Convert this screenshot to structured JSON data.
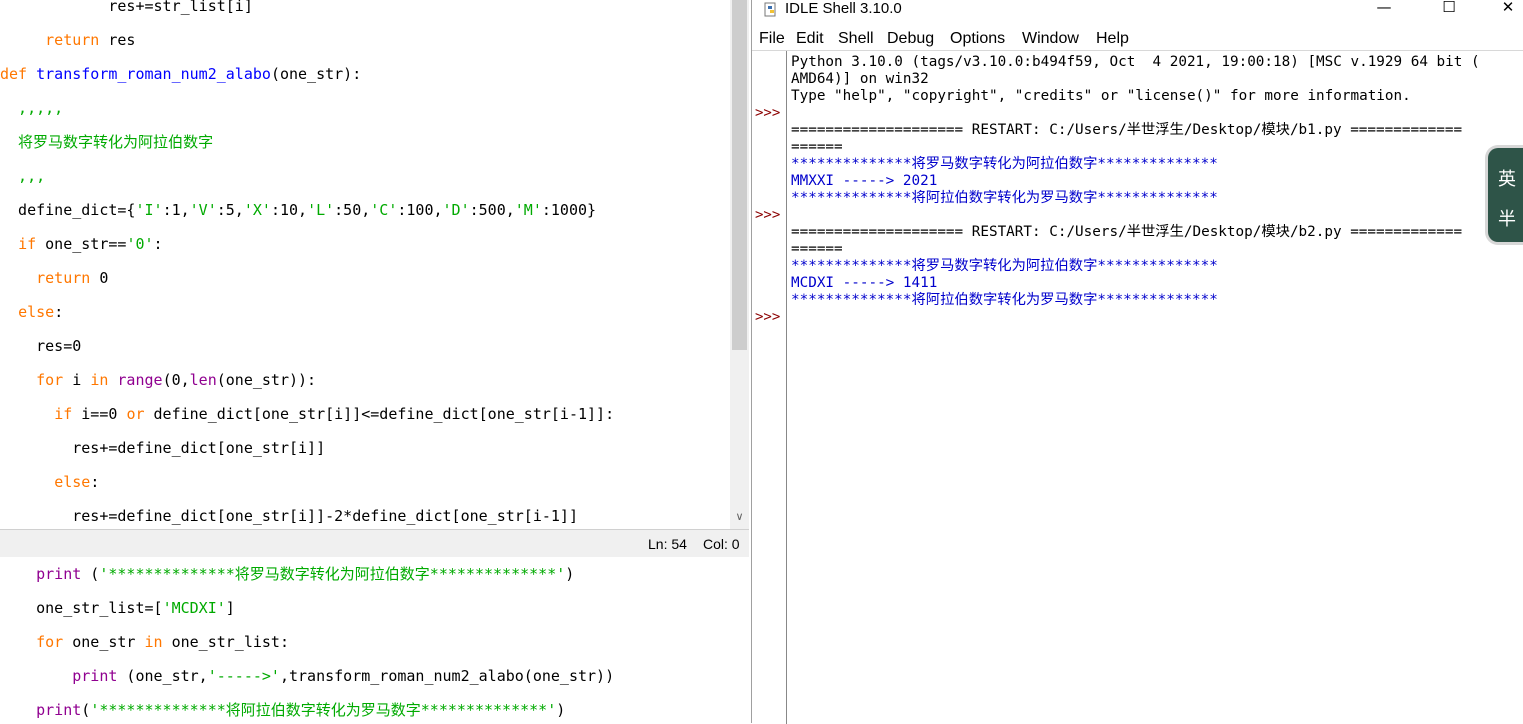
{
  "editor": {
    "lines": [
      {
        "segs": [
          {
            "t": "            res+=str_list[i]",
            "c": ""
          }
        ]
      },
      {
        "segs": [
          {
            "t": "     ",
            "c": ""
          },
          {
            "t": "return",
            "c": "kw"
          },
          {
            "t": " res",
            "c": ""
          }
        ]
      },
      {
        "segs": [
          {
            "t": "def",
            "c": "kw"
          },
          {
            "t": " ",
            "c": ""
          },
          {
            "t": "transform_roman_num2_alabo",
            "c": "def"
          },
          {
            "t": "(one_str):",
            "c": ""
          }
        ]
      },
      {
        "segs": [
          {
            "t": "  ,,,,,",
            "c": "str"
          }
        ]
      },
      {
        "segs": [
          {
            "t": "  将罗马数字转化为阿拉伯数字",
            "c": "str"
          }
        ]
      },
      {
        "segs": [
          {
            "t": "  ,,,",
            "c": "str"
          }
        ]
      },
      {
        "segs": [
          {
            "t": "  define_dict={",
            "c": ""
          },
          {
            "t": "'I'",
            "c": "str"
          },
          {
            "t": ":1,",
            "c": ""
          },
          {
            "t": "'V'",
            "c": "str"
          },
          {
            "t": ":5,",
            "c": ""
          },
          {
            "t": "'X'",
            "c": "str"
          },
          {
            "t": ":10,",
            "c": ""
          },
          {
            "t": "'L'",
            "c": "str"
          },
          {
            "t": ":50,",
            "c": ""
          },
          {
            "t": "'C'",
            "c": "str"
          },
          {
            "t": ":100,",
            "c": ""
          },
          {
            "t": "'D'",
            "c": "str"
          },
          {
            "t": ":500,",
            "c": ""
          },
          {
            "t": "'M'",
            "c": "str"
          },
          {
            "t": ":1000}",
            "c": ""
          }
        ]
      },
      {
        "segs": [
          {
            "t": "  ",
            "c": ""
          },
          {
            "t": "if",
            "c": "kw"
          },
          {
            "t": " one_str==",
            "c": ""
          },
          {
            "t": "'0'",
            "c": "str"
          },
          {
            "t": ":",
            "c": ""
          }
        ]
      },
      {
        "segs": [
          {
            "t": "    ",
            "c": ""
          },
          {
            "t": "return",
            "c": "kw"
          },
          {
            "t": " 0",
            "c": ""
          }
        ]
      },
      {
        "segs": [
          {
            "t": "  ",
            "c": ""
          },
          {
            "t": "else",
            "c": "kw"
          },
          {
            "t": ":",
            "c": ""
          }
        ]
      },
      {
        "segs": [
          {
            "t": "    res=0",
            "c": ""
          }
        ]
      },
      {
        "segs": [
          {
            "t": "    ",
            "c": ""
          },
          {
            "t": "for",
            "c": "kw"
          },
          {
            "t": " i ",
            "c": ""
          },
          {
            "t": "in",
            "c": "kw"
          },
          {
            "t": " ",
            "c": ""
          },
          {
            "t": "range",
            "c": "bi"
          },
          {
            "t": "(0,",
            "c": ""
          },
          {
            "t": "len",
            "c": "bi"
          },
          {
            "t": "(one_str)):",
            "c": ""
          }
        ]
      },
      {
        "segs": [
          {
            "t": "      ",
            "c": ""
          },
          {
            "t": "if",
            "c": "kw"
          },
          {
            "t": " i==0 ",
            "c": ""
          },
          {
            "t": "or",
            "c": "kw"
          },
          {
            "t": " define_dict[one_str[i]]<=define_dict[one_str[i-1]]:",
            "c": ""
          }
        ]
      },
      {
        "segs": [
          {
            "t": "        res+=define_dict[one_str[i]]",
            "c": ""
          }
        ]
      },
      {
        "segs": [
          {
            "t": "      ",
            "c": ""
          },
          {
            "t": "else",
            "c": "kw"
          },
          {
            "t": ":",
            "c": ""
          }
        ]
      },
      {
        "segs": [
          {
            "t": "        res+=define_dict[one_str[i]]-2*define_dict[one_str[i-1]]",
            "c": ""
          }
        ]
      }
    ],
    "lines2": [
      {
        "segs": [
          {
            "t": "    ",
            "c": ""
          },
          {
            "t": "print",
            "c": "bi"
          },
          {
            "t": " (",
            "c": ""
          },
          {
            "t": "'**************将罗马数字转化为阿拉伯数字**************'",
            "c": "str"
          },
          {
            "t": ")",
            "c": ""
          }
        ]
      },
      {
        "segs": [
          {
            "t": "    one_str_list=[",
            "c": ""
          },
          {
            "t": "'MCDXI'",
            "c": "str"
          },
          {
            "t": "]",
            "c": ""
          }
        ]
      },
      {
        "segs": [
          {
            "t": "    ",
            "c": ""
          },
          {
            "t": "for",
            "c": "kw"
          },
          {
            "t": " one_str ",
            "c": ""
          },
          {
            "t": "in",
            "c": "kw"
          },
          {
            "t": " one_str_list:",
            "c": ""
          }
        ]
      },
      {
        "segs": [
          {
            "t": "        ",
            "c": ""
          },
          {
            "t": "print",
            "c": "bi"
          },
          {
            "t": " (one_str,",
            "c": ""
          },
          {
            "t": "'----->'",
            "c": "str"
          },
          {
            "t": ",transform_roman_num2_alabo(one_str))",
            "c": ""
          }
        ]
      },
      {
        "segs": [
          {
            "t": "    ",
            "c": ""
          },
          {
            "t": "print",
            "c": "bi"
          },
          {
            "t": "(",
            "c": ""
          },
          {
            "t": "'**************将阿拉伯数字转化为罗马数字**************'",
            "c": "str"
          },
          {
            "t": ")",
            "c": ""
          }
        ]
      }
    ],
    "status_ln": "Ln: 54",
    "status_col": "Col: 0"
  },
  "shell": {
    "title": "IDLE Shell 3.10.0",
    "window_controls": {
      "minimize": "—",
      "maximize": "☐",
      "close": "✕"
    },
    "menu": [
      "File",
      "Edit",
      "Shell",
      "Debug",
      "Options",
      "Window",
      "Help"
    ],
    "prompt": ">>>",
    "lines": [
      {
        "text": "Python 3.10.0 (tags/v3.10.0:b494f59, Oct  4 2021, 19:00:18) [MSC v.1929 64 bit (",
        "blue": false
      },
      {
        "text": "AMD64)] on win32",
        "blue": false
      },
      {
        "text": "Type \"help\", \"copyright\", \"credits\" or \"license()\" for more information.",
        "blue": false
      },
      {
        "text": "",
        "blue": false
      },
      {
        "text": "==================== RESTART: C:/Users/半世浮生/Desktop/模块/b1.py =============",
        "blue": false
      },
      {
        "text": "======",
        "blue": false
      },
      {
        "text": "**************将罗马数字转化为阿拉伯数字**************",
        "blue": true
      },
      {
        "text": "MMXXI -----> 2021",
        "blue": true
      },
      {
        "text": "**************将阿拉伯数字转化为罗马数字**************",
        "blue": true
      },
      {
        "text": "",
        "blue": false
      },
      {
        "text": "==================== RESTART: C:/Users/半世浮生/Desktop/模块/b2.py =============",
        "blue": false
      },
      {
        "text": "======",
        "blue": false
      },
      {
        "text": "**************将罗马数字转化为阿拉伯数字**************",
        "blue": true
      },
      {
        "text": "MCDXI -----> 1411",
        "blue": true
      },
      {
        "text": "**************将阿拉伯数字转化为罗马数字**************",
        "blue": true
      }
    ]
  },
  "ime": {
    "mode1": "英",
    "mode2": "半"
  }
}
